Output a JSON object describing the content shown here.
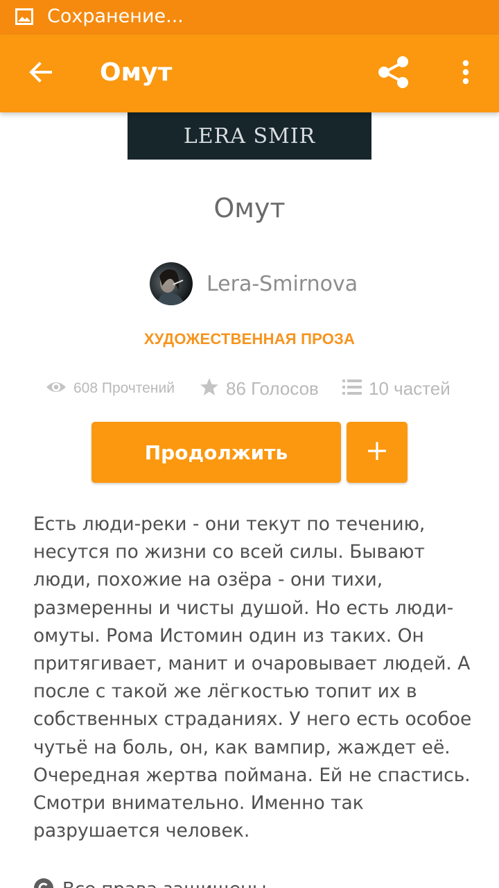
{
  "status_bar": {
    "text": "Сохранение...",
    "icon": "image-icon",
    "background": "#f58a0e"
  },
  "toolbar": {
    "title": "Омут",
    "back_icon": "arrow-left-icon",
    "share_icon": "share-icon",
    "more_icon": "more-vertical-icon",
    "background": "#fb980f"
  },
  "cover": {
    "text": "LERA SMIR"
  },
  "story": {
    "title": "Омут",
    "author": "Lera-Smirnova",
    "genre": "ХУДОЖЕСТВЕННАЯ ПРОЗА",
    "genre_color": "#f7941d"
  },
  "stats": {
    "reads": "608 Прочтений",
    "votes": "86 Голосов",
    "parts": "10 частей"
  },
  "actions": {
    "continue_label": "Продолжить",
    "add_label": "+",
    "accent": "#fb980f"
  },
  "description": "Есть люди-реки - они текут по течению, несутся по жизни со всей силы. Бывают люди, похожие на озёра - они тихи, размеренны и чисты душой. Но есть люди-омуты.  Рома Истомин один из таких. Он притягивает, манит и очаровывает людей. А после с такой же лёгкостью топит их в собственных страданиях. У него есть особое чутьё на боль, он, как вампир, жаждет её.  Очередная жертва поймана.  Ей не спастись. Смотри внимательно. Именно так разрушается человек.",
  "footer": {
    "rights": "Все права защищены",
    "icon": "copyright-icon"
  }
}
